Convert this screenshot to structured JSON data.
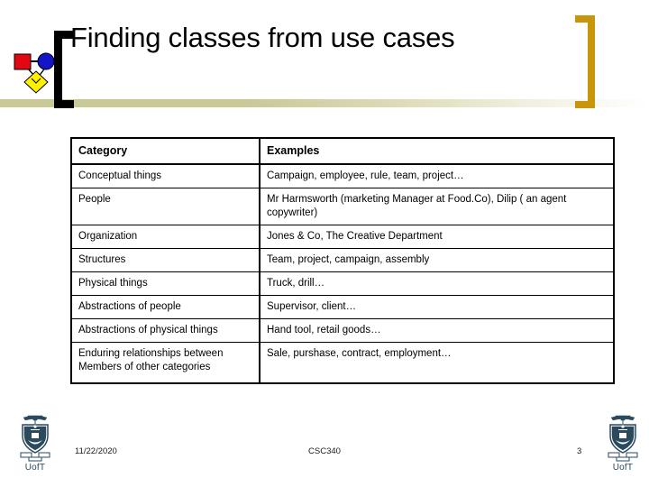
{
  "slide": {
    "title": "Finding classes from use cases",
    "decorations": {
      "left_bracket_color": "#000000",
      "right_bracket_color": "#c8960c",
      "band_color": "#c9c897"
    },
    "logo_icon": "uml-class-diagram-icon"
  },
  "table": {
    "headers": [
      "Category",
      "Examples"
    ],
    "rows": [
      {
        "category": "Conceptual things",
        "examples": "Campaign, employee, rule, team, project…"
      },
      {
        "category": "People",
        "examples": "Mr Harmsworth (marketing Manager at Food.Co), Dilip ( an agent copywriter)"
      },
      {
        "category": "Organization",
        "examples": "Jones & Co, The Creative Department"
      },
      {
        "category": "Structures",
        "examples": "Team, project, campaign, assembly"
      },
      {
        "category": "Physical things",
        "examples": "Truck, drill…"
      },
      {
        "category": "Abstractions of people",
        "examples": "Supervisor, client…"
      },
      {
        "category": "Abstractions of physical things",
        "examples": "Hand tool, retail goods…"
      },
      {
        "category": "Enduring relationships between Members of other categories",
        "examples": "Sale, purshase, contract, employment…"
      }
    ]
  },
  "footer": {
    "date": "11/22/2020",
    "course": "CSC340",
    "slide_number": "3",
    "crest_label": "UofT",
    "crest_color": "#2b4a5e"
  }
}
